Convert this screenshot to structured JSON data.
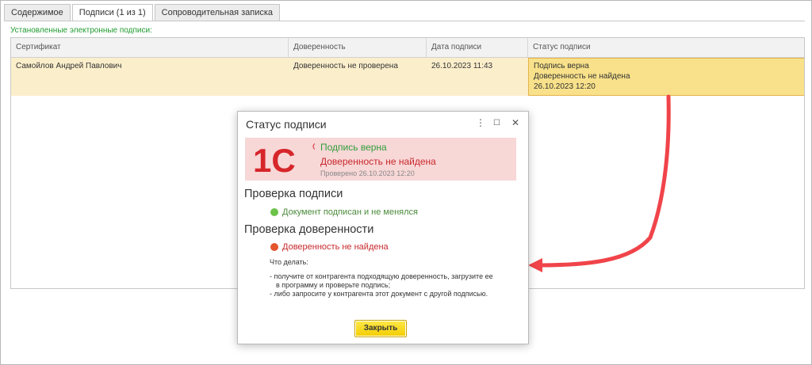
{
  "tabs": [
    "Содержимое",
    "Подписи (1 из 1)",
    "Сопроводительная записка"
  ],
  "section_label": "Установленные электронные подписи:",
  "grid": {
    "headers": [
      "Сертификат",
      "Доверенность",
      "Дата подписи",
      "Статус подписи"
    ],
    "row": {
      "certificate": "Самойлов Андрей Павлович",
      "power_of_attorney": "Доверенность не проверена",
      "date": "26.10.2023 11:43",
      "status_lines": [
        "Подпись верна",
        "Доверенность не найдена",
        "26.10.2023 12:20"
      ]
    }
  },
  "dialog": {
    "title": "Статус подписи",
    "banner": {
      "logo_text": "1С",
      "line1": "Подпись верна",
      "line2": "Доверенность не найдена",
      "line3": "Проверено 26.10.2023 12:20"
    },
    "section1_title": "Проверка подписи",
    "section1_status": "Документ подписан и не менялся",
    "section2_title": "Проверка доверенности",
    "section2_status": "Доверенность не найдена",
    "what_to_do": "Что делать:",
    "instructions": [
      "- получите от контрагента подходящую доверенность, загрузите ее",
      "в программу и проверьте подпись;",
      "- либо запросите у контрагента этот документ с другой подписью."
    ],
    "close_button": "Закрыть"
  },
  "colors": {
    "ok": "#2f9e3a",
    "error": "#c8282c",
    "highlight": "#f8e18a",
    "arrow": "#f0444a"
  }
}
